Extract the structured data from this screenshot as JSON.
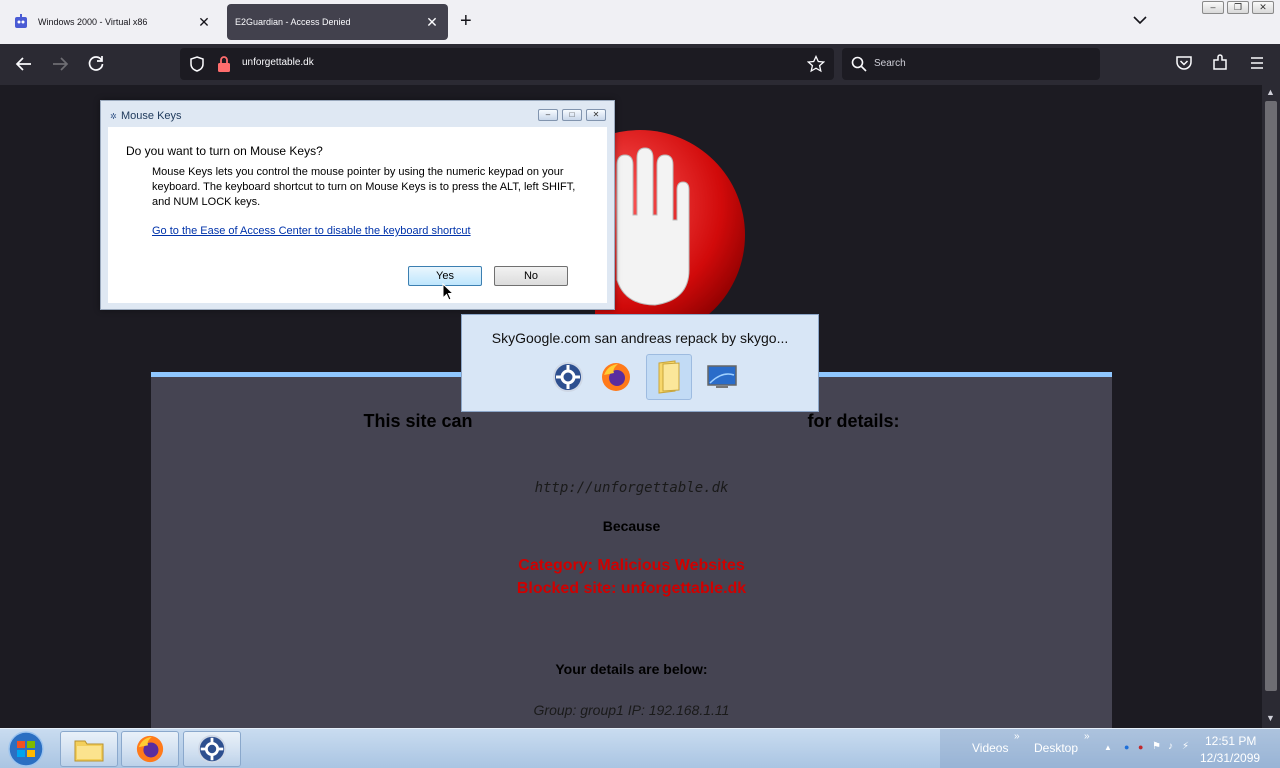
{
  "browser": {
    "tabs": [
      {
        "label": "Windows 2000 - Virtual x86",
        "active": false
      },
      {
        "label": "E2Guardian - Access Denied",
        "active": true
      }
    ],
    "url": "unforgettable.dk",
    "search_placeholder": "Search"
  },
  "page": {
    "heading_left": "This site can",
    "heading_right": "for details:",
    "blocked_url": "http://unforgettable.dk",
    "because": "Because",
    "category": "Category: Malicious Websites",
    "blocked_site": "Blocked site: unforgettable.dk",
    "details_heading": "Your details are below:",
    "group_ip": "Group: group1   IP: 192.168.1.11"
  },
  "dialog": {
    "title": "Mouse Keys",
    "question": "Do you want to turn on Mouse Keys?",
    "description": "Mouse Keys lets you control the mouse pointer by using the numeric keypad on your keyboard.  The keyboard shortcut to turn on Mouse Keys is to press the ALT, left SHIFT, and NUM LOCK keys.",
    "link": "Go to the Ease of Access Center to disable the keyboard shortcut",
    "yes_label": "Yes",
    "no_label": "No"
  },
  "thumbnail": {
    "title": "SkyGoogle.com san andreas repack by skygo..."
  },
  "taskbar": {
    "toolbar_videos": "Videos",
    "toolbar_desktop": "Desktop",
    "time": "12:51 PM",
    "date": "12/31/2099"
  },
  "colors": {
    "accent": "#8fc7ff",
    "blocked_red": "#d00000",
    "panel": "#454452"
  }
}
